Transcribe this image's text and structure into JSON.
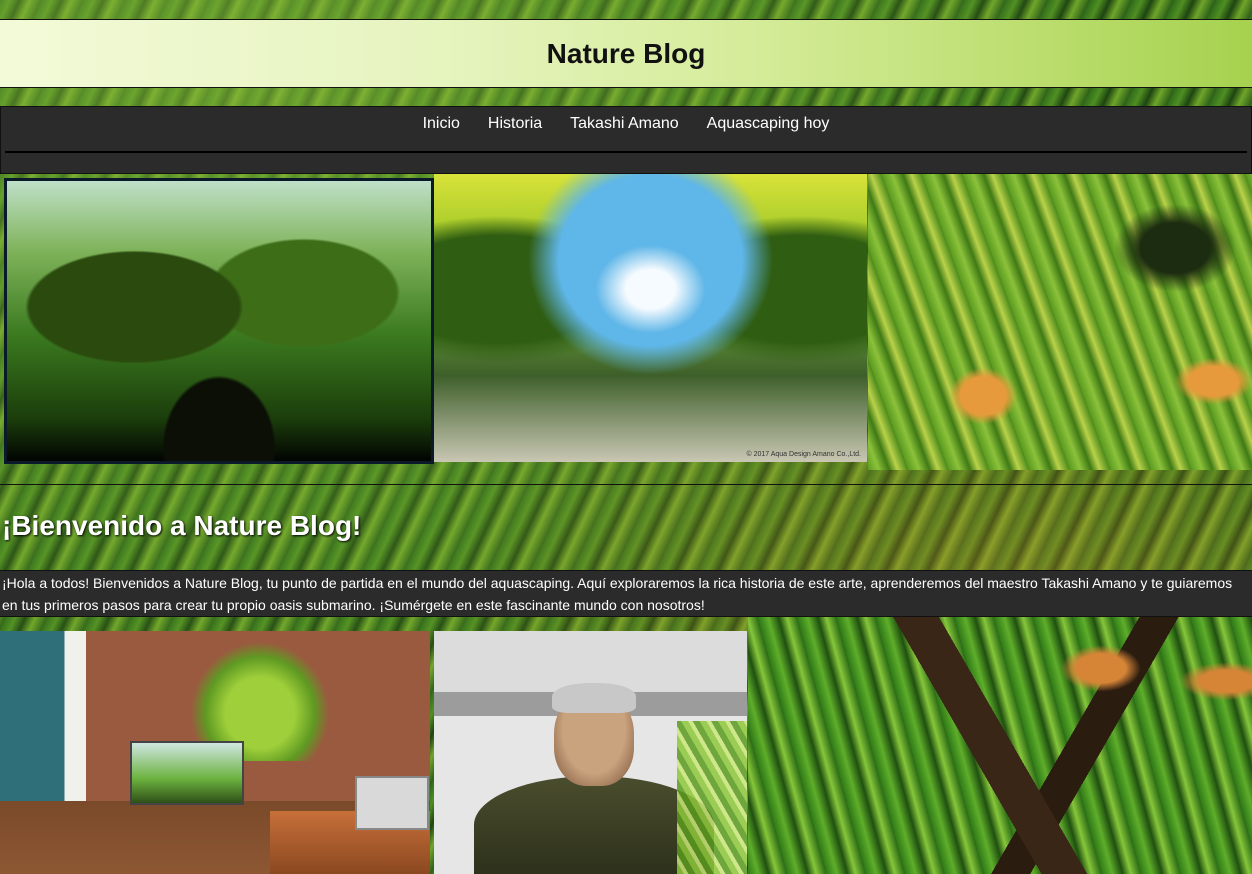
{
  "header": {
    "title": "Nature Blog"
  },
  "nav": {
    "items": [
      {
        "label": "Inicio"
      },
      {
        "label": "Historia"
      },
      {
        "label": "Takashi Amano"
      },
      {
        "label": "Aquascaping hoy"
      }
    ]
  },
  "gallery": {
    "aquarium_2_credit": "© 2017 Aqua Design Amano Co.,Ltd."
  },
  "welcome": {
    "title": "¡Bienvenido a Nature Blog!",
    "intro": "¡Hola a todos! Bienvenidos a Nature Blog, tu punto de partida en el mundo del aquascaping. Aquí exploraremos la rica historia de este arte, aprenderemos del maestro Takashi Amano y te guiaremos en tus primeros pasos para crear tu propio oasis submarino. ¡Sumérgete en este fascinante mundo con nosotros!"
  },
  "colors": {
    "nav_background": "#2b2b2b",
    "text_light": "#ffffff",
    "header_background": "#e6f4bf"
  }
}
